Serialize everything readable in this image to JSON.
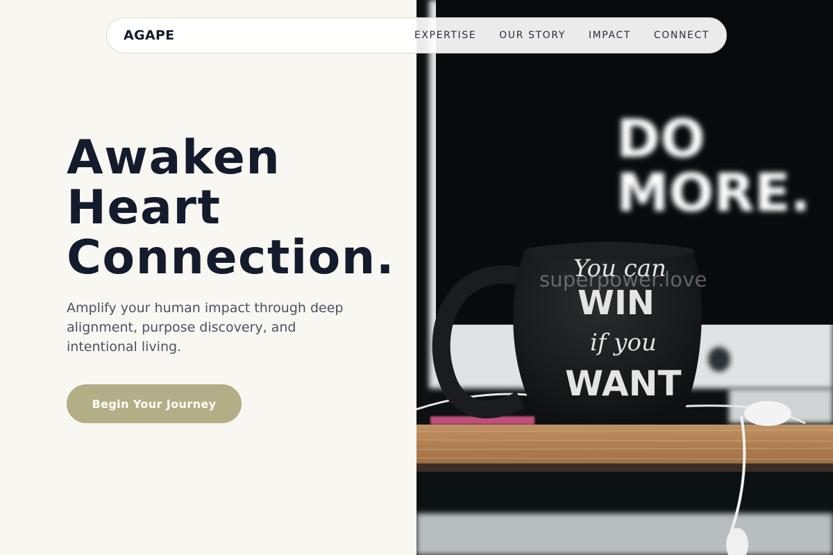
{
  "brand": "AGAPE",
  "nav": {
    "items": [
      "EXPERTISE",
      "OUR STORY",
      "IMPACT",
      "CONNECT"
    ]
  },
  "hero": {
    "title_lines": [
      "Awaken",
      "Heart",
      "Connection."
    ],
    "subtitle": "Amplify your human impact through deep alignment, purpose discovery, and intentional living.",
    "cta_label": "Begin Your Journey"
  },
  "photo": {
    "sign_text": [
      "DO",
      "MORE."
    ],
    "mug_text": [
      "You can",
      "WIN",
      "if you",
      "WANT"
    ],
    "watermark": "superpower.love"
  },
  "colors": {
    "background": "#f8f7f2",
    "text_dark": "#141b2c",
    "accent": "#b4ae87"
  }
}
